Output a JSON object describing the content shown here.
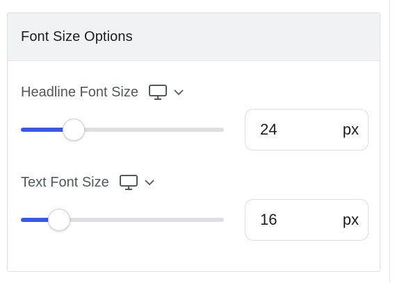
{
  "panel": {
    "title": "Font Size Options"
  },
  "controls": [
    {
      "label": "Headline Font Size",
      "device_icon": "desktop-icon",
      "dropdown_icon": "chevron-down-icon",
      "value": "24",
      "unit": "px",
      "slider_fraction": 0.26
    },
    {
      "label": "Text Font Size",
      "device_icon": "desktop-icon",
      "dropdown_icon": "chevron-down-icon",
      "value": "16",
      "unit": "px",
      "slider_fraction": 0.19
    }
  ],
  "colors": {
    "accent": "#3858e9",
    "track": "#dddfe2",
    "label": "#50575e",
    "header_bg": "#f1f2f4"
  }
}
